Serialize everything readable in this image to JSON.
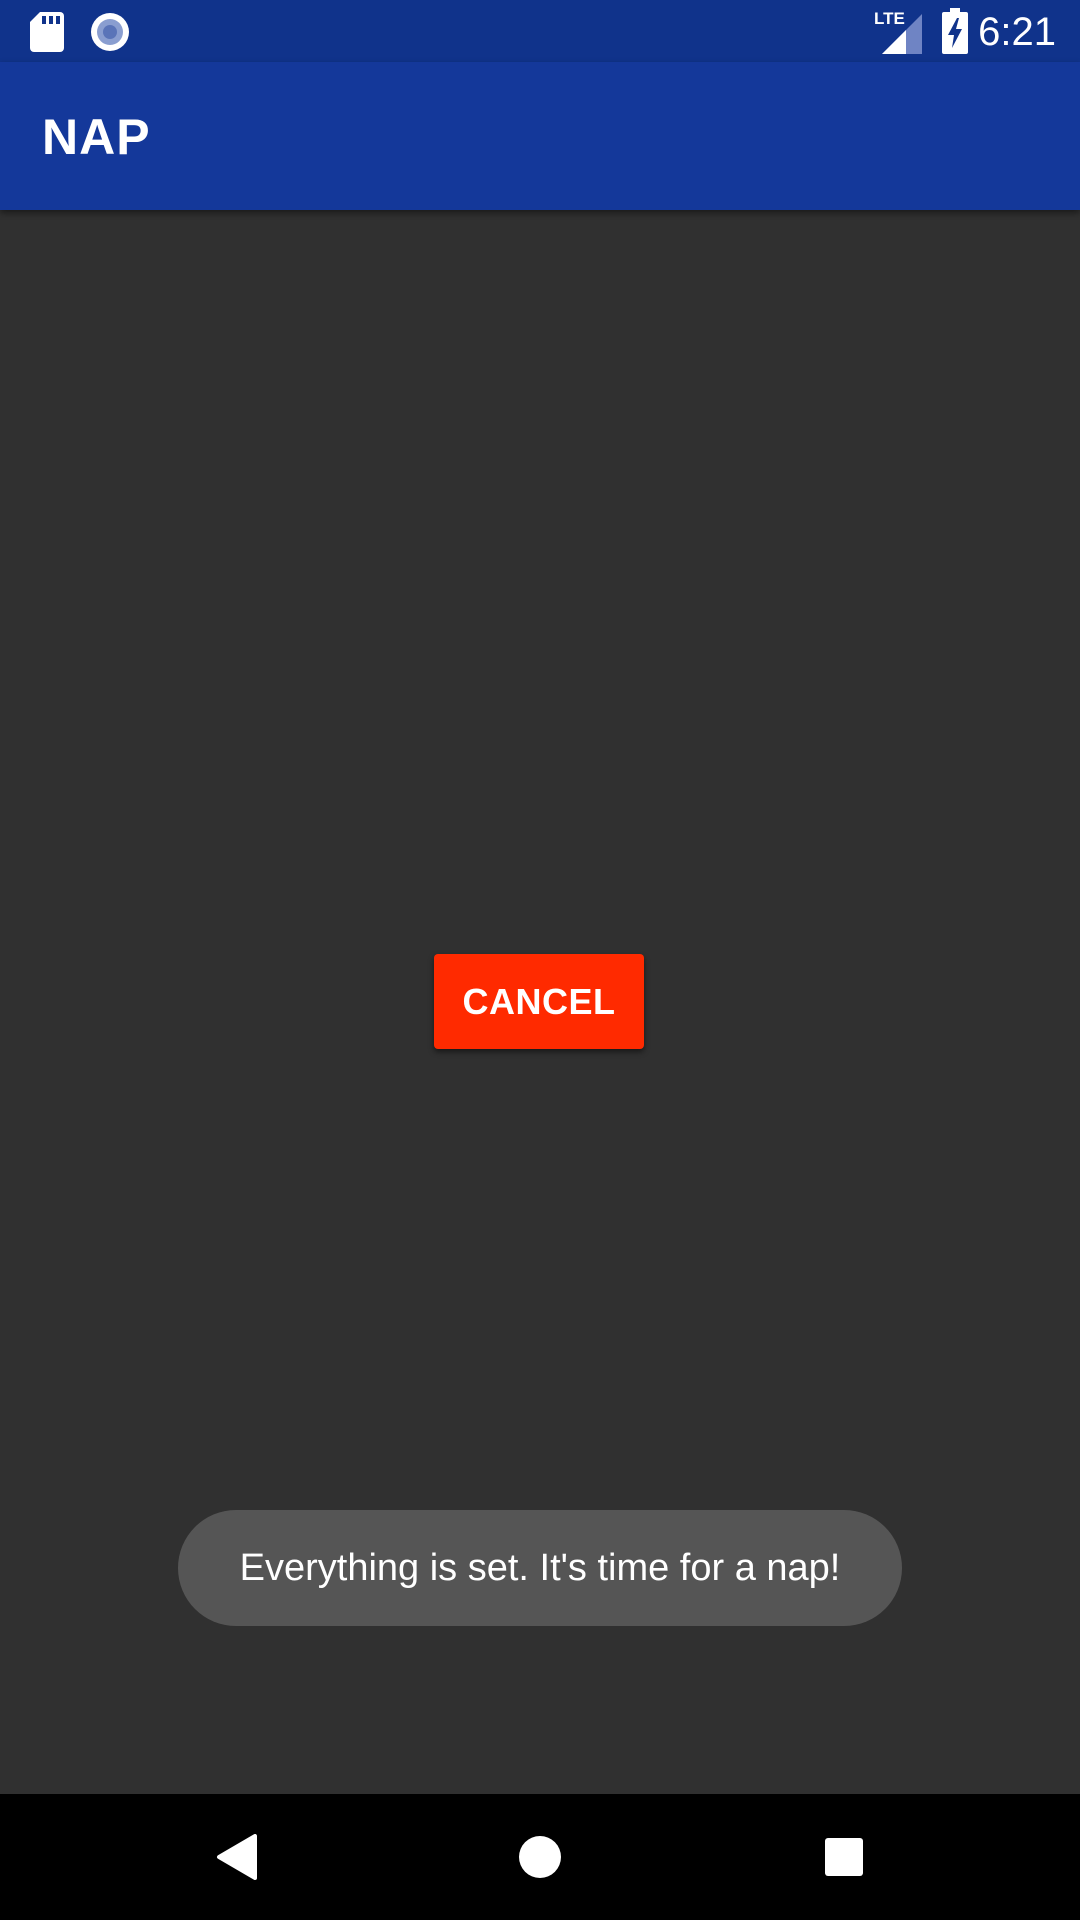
{
  "status_bar": {
    "time": "6:21",
    "network_label": "LTE",
    "icons": [
      "sd-card-icon",
      "record-icon",
      "lte-signal-icon",
      "battery-charging-icon"
    ]
  },
  "app_bar": {
    "title": "NAP",
    "background": "#14389a"
  },
  "main": {
    "cancel_button_label": "CANCEL",
    "cancel_button_color": "#ff2a00"
  },
  "toast": {
    "message": "Everything is set. It's time for a nap!"
  },
  "nav_bar": {
    "back_icon": "back-triangle-icon",
    "home_icon": "home-circle-icon",
    "recents_icon": "recents-square-icon"
  }
}
